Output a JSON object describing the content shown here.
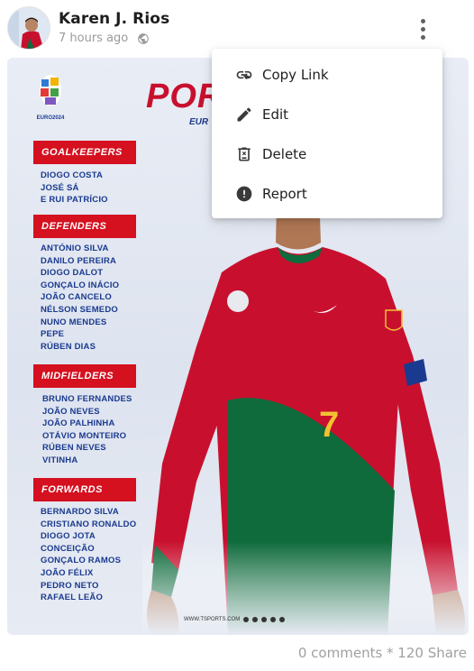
{
  "post": {
    "author": "Karen J. Rios",
    "time": "7 hours ago",
    "visibility_icon": "globe-icon",
    "stats": "0 comments * 120 Share"
  },
  "menu": {
    "items": [
      {
        "label": "Copy Link",
        "icon": "copy-link-icon"
      },
      {
        "label": "Edit",
        "icon": "edit-pencil-icon"
      },
      {
        "label": "Delete",
        "icon": "trash-icon"
      },
      {
        "label": "Report",
        "icon": "report-alert-icon"
      }
    ]
  },
  "poster": {
    "logo_text": "EURO2024",
    "title": "POR",
    "subtitle": "EUR",
    "sections": [
      {
        "heading": "GOALKEEPERS",
        "players": [
          "DIOGO COSTA",
          "JOSÉ SÁ",
          "E RUI PATRÍCIO"
        ]
      },
      {
        "heading": "DEFENDERS",
        "players": [
          "ANTÓNIO SILVA",
          "DANILO PEREIRA",
          "DIOGO DALOT",
          "GONÇALO INÁCIO",
          "JOÃO CANCELO",
          "NÉLSON SEMEDO",
          "NUNO MENDES",
          "PEPE",
          "RÚBEN DIAS"
        ]
      },
      {
        "heading": "MIDFIELDERS",
        "players": [
          "BRUNO FERNANDES",
          "JOÃO NEVES",
          "JOÃO PALHINHA",
          "OTÁVIO MONTEIRO",
          "RÚBEN NEVES",
          "VITINHA"
        ]
      },
      {
        "heading": "FORWARDS",
        "players": [
          "BERNARDO SILVA",
          "CRISTIANO RONALDO",
          "DIOGO JOTA",
          "CONCEIÇÃO",
          "GONÇALO RAMOS",
          "JOÃO FÉLIX",
          "PEDRO NETO",
          "RAFAEL LEÃO"
        ]
      }
    ],
    "shirt_number": "7",
    "footer": "WWW.TSPORTS.COM"
  },
  "colors": {
    "portugal_red": "#d5101f",
    "portugal_green": "#0f6b3c",
    "navy_text": "#1a3a8f"
  }
}
